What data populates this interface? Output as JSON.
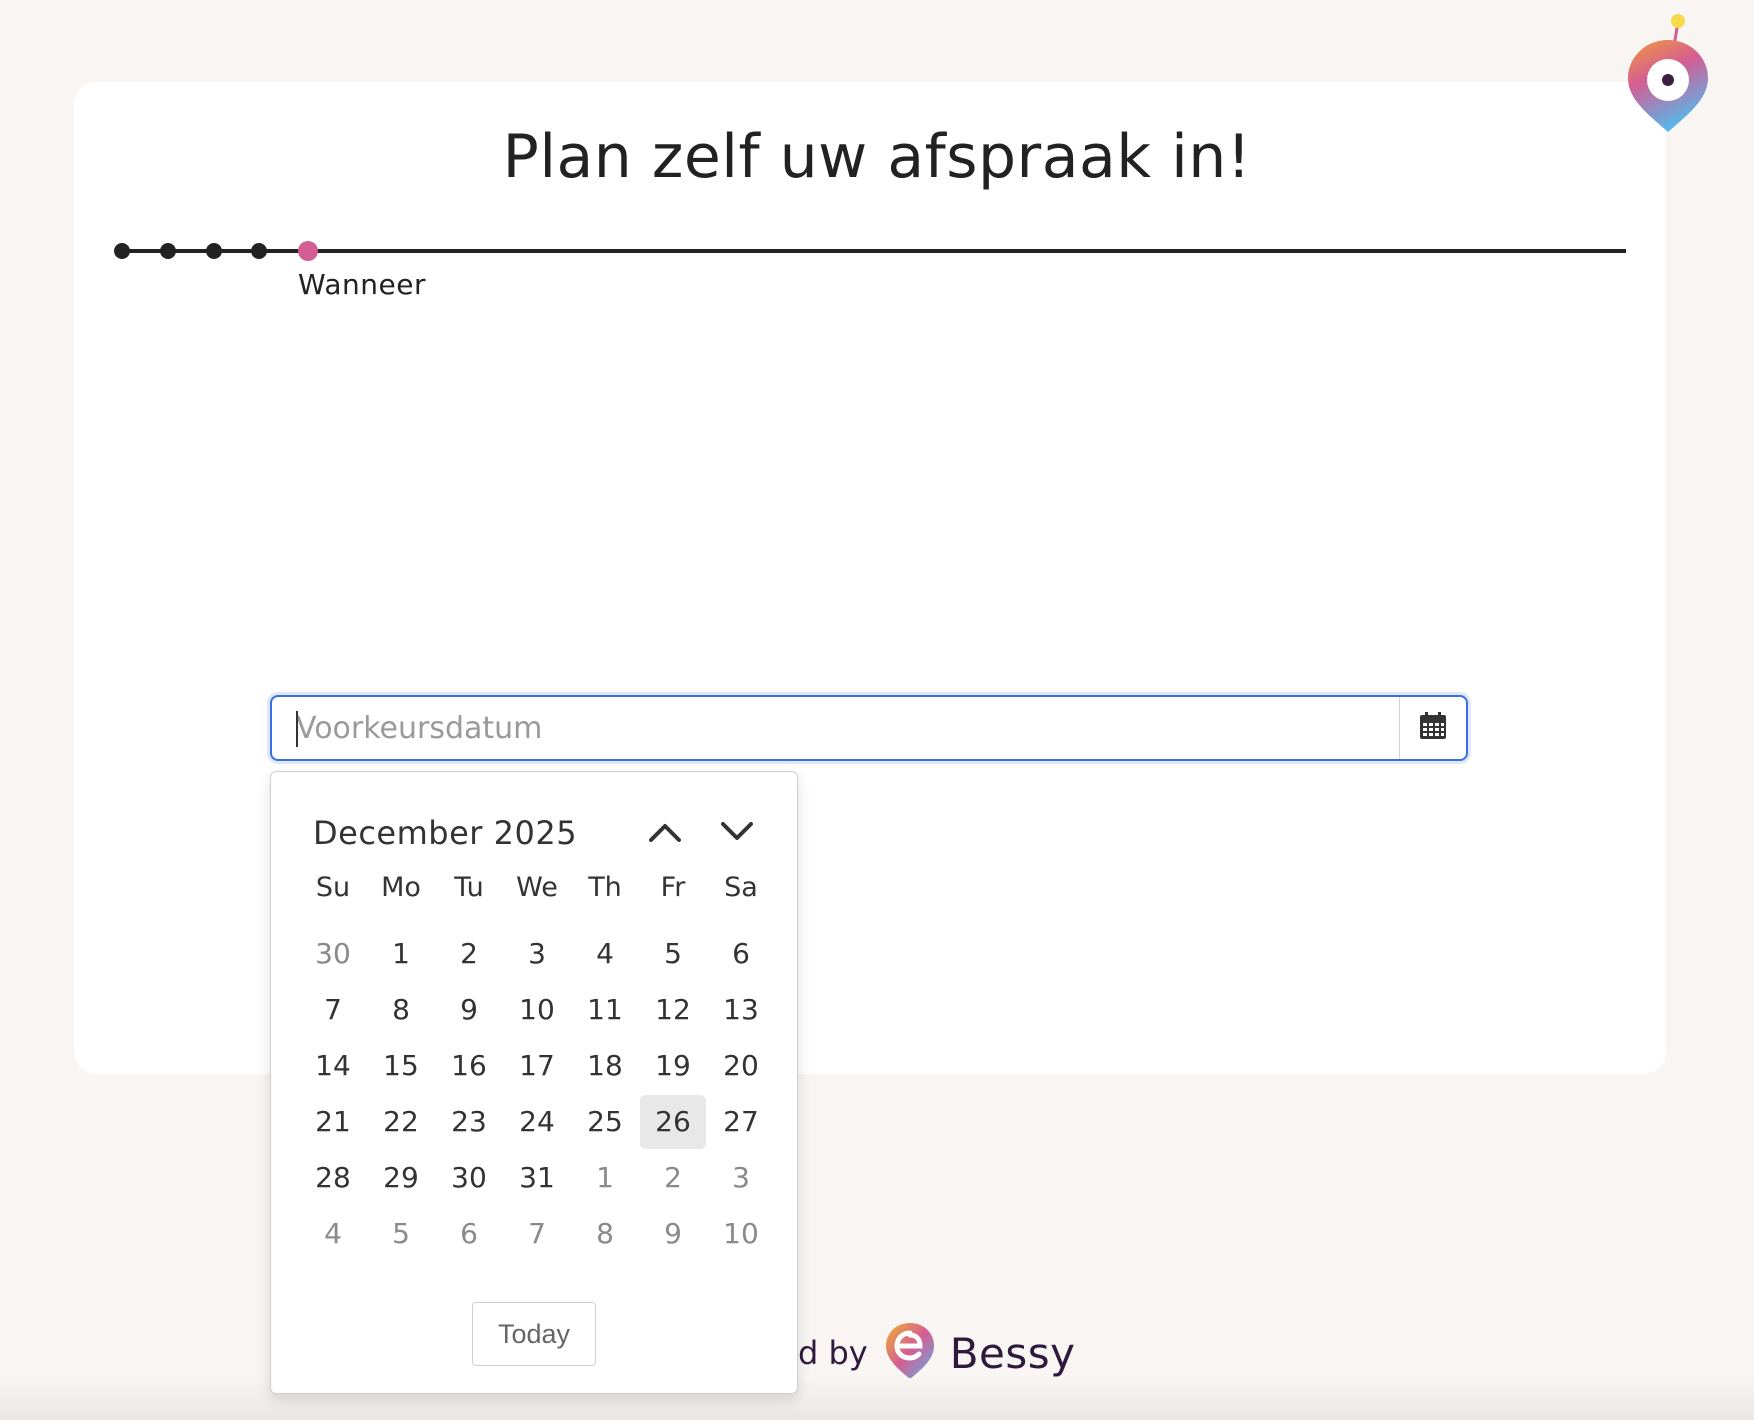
{
  "page": {
    "title": "Plan zelf uw afspraak in!"
  },
  "progress": {
    "completed_steps": 4,
    "active_step_label": "Wanneer",
    "active_color": "#d45d93"
  },
  "date_input": {
    "placeholder": "Voorkeursdatum",
    "value": "",
    "icon": "calendar-icon",
    "focus_color": "#3a6ee8"
  },
  "datepicker": {
    "month_label": "December 2025",
    "nav_prev_icon": "chevron-up-icon",
    "nav_next_icon": "chevron-down-icon",
    "weekdays": [
      "Su",
      "Mo",
      "Tu",
      "We",
      "Th",
      "Fr",
      "Sa"
    ],
    "weeks": [
      [
        {
          "d": "30",
          "muted": true
        },
        {
          "d": "1"
        },
        {
          "d": "2"
        },
        {
          "d": "3"
        },
        {
          "d": "4"
        },
        {
          "d": "5"
        },
        {
          "d": "6"
        }
      ],
      [
        {
          "d": "7"
        },
        {
          "d": "8"
        },
        {
          "d": "9"
        },
        {
          "d": "10"
        },
        {
          "d": "11"
        },
        {
          "d": "12"
        },
        {
          "d": "13"
        }
      ],
      [
        {
          "d": "14"
        },
        {
          "d": "15"
        },
        {
          "d": "16"
        },
        {
          "d": "17"
        },
        {
          "d": "18"
        },
        {
          "d": "19"
        },
        {
          "d": "20"
        }
      ],
      [
        {
          "d": "21"
        },
        {
          "d": "22"
        },
        {
          "d": "23"
        },
        {
          "d": "24"
        },
        {
          "d": "25"
        },
        {
          "d": "26",
          "today": true
        },
        {
          "d": "27"
        }
      ],
      [
        {
          "d": "28"
        },
        {
          "d": "29"
        },
        {
          "d": "30"
        },
        {
          "d": "31"
        },
        {
          "d": "1",
          "muted": true
        },
        {
          "d": "2",
          "muted": true
        },
        {
          "d": "3",
          "muted": true
        }
      ],
      [
        {
          "d": "4",
          "muted": true
        },
        {
          "d": "5",
          "muted": true
        },
        {
          "d": "6",
          "muted": true
        },
        {
          "d": "7",
          "muted": true
        },
        {
          "d": "8",
          "muted": true
        },
        {
          "d": "9",
          "muted": true
        },
        {
          "d": "10",
          "muted": true
        }
      ]
    ],
    "today_button": "Today"
  },
  "footer": {
    "prefix": "d by",
    "brand": "Bessy",
    "brand_icon": "bessy-logo-icon",
    "brand_color": "#2f1a3d"
  },
  "corner": {
    "icon": "bessy-pin-icon"
  }
}
